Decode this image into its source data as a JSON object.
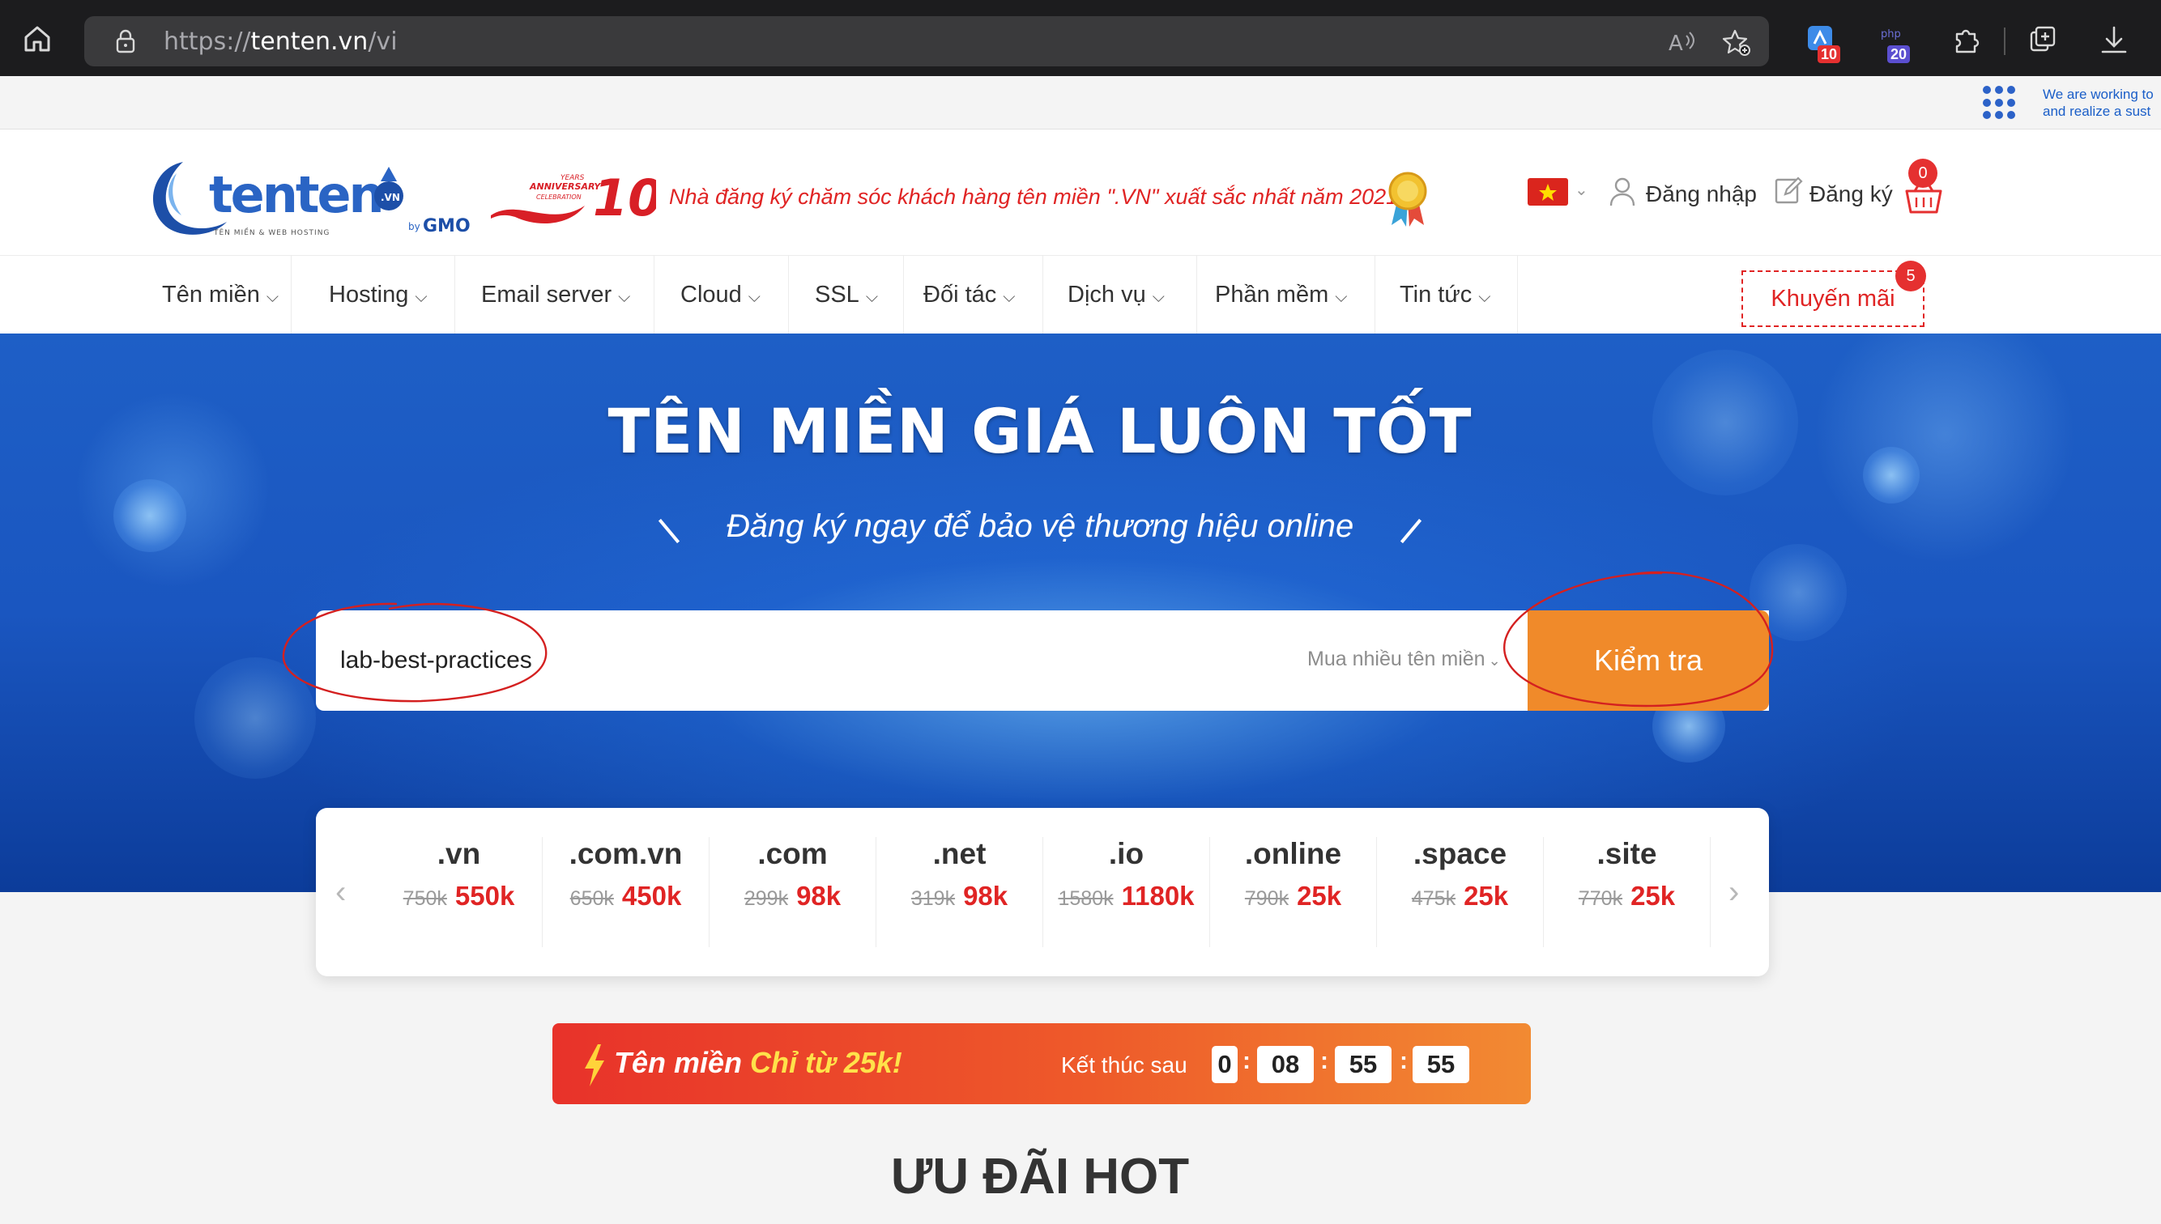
{
  "browser": {
    "url_scheme": "https://",
    "url_host": "tenten.vn",
    "url_path": "/vi",
    "ext_badge_1": "10",
    "ext_badge_2": "20"
  },
  "notice": {
    "line1": "We are working to",
    "line2": "and realize a sust"
  },
  "header": {
    "award_text": "Nhà đăng ký chăm sóc khách hàng tên miền \".VN\" xuất sắc nhất năm 2021",
    "login": "Đăng nhập",
    "register": "Đăng ký",
    "cart_count": "0"
  },
  "logo": {
    "brand": "tenten",
    "tagline": "TÊN MIỀN & WEB HOSTING",
    "by": "by",
    "gmo": "GMO",
    "badge": ".VN",
    "anniversary_number": "10",
    "anniversary_text": "ANNIVERSARY",
    "years_text": "YEARS",
    "celebration_text": "CELEBRATION"
  },
  "nav": {
    "items": [
      "Tên miền",
      "Hosting",
      "Email server",
      "Cloud",
      "SSL",
      "Đối tác",
      "Dịch vụ",
      "Phần mềm",
      "Tin tức"
    ],
    "promo": "Khuyến mãi",
    "promo_count": "5"
  },
  "hero": {
    "title": "TÊN MIỀN GIÁ LUÔN TỐT",
    "subtitle": "Đăng ký ngay để bảo vệ thương hiệu online",
    "search_value": "lab-best-practices",
    "multi_label": "Mua nhiều tên miền",
    "check_button": "Kiểm tra"
  },
  "prices": [
    {
      "tld": ".vn",
      "old": "750k",
      "new": "550k"
    },
    {
      "tld": ".com.vn",
      "old": "650k",
      "new": "450k"
    },
    {
      "tld": ".com",
      "old": "299k",
      "new": "98k"
    },
    {
      "tld": ".net",
      "old": "319k",
      "new": "98k"
    },
    {
      "tld": ".io",
      "old": "1580k",
      "new": "1180k"
    },
    {
      "tld": ".online",
      "old": "790k",
      "new": "25k"
    },
    {
      "tld": ".space",
      "old": "475k",
      "new": "25k"
    },
    {
      "tld": ".site",
      "old": "770k",
      "new": "25k"
    }
  ],
  "countdown": {
    "title_part1": "Tên miền ",
    "title_highlight": "Chỉ từ 25k!",
    "ends_label": "Kết thúc sau",
    "days": "0",
    "hours": "08",
    "minutes": "55",
    "seconds": "55"
  },
  "hot_title": "ƯU ĐÃI HOT",
  "colors": {
    "accent_red": "#e02424",
    "accent_orange": "#f08a2a",
    "hero_blue": "#1a56c0"
  }
}
